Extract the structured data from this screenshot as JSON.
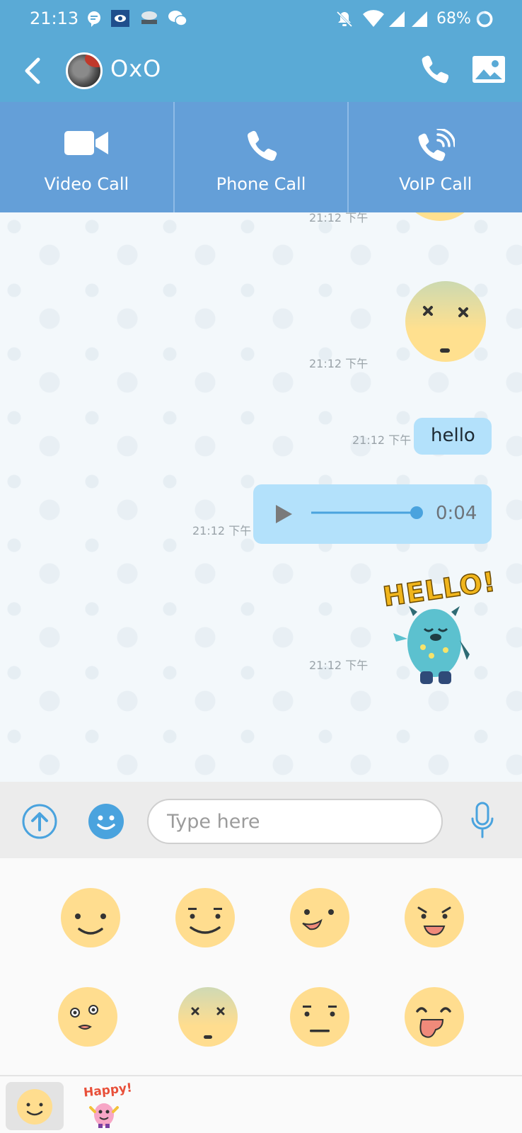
{
  "status_bar": {
    "time": "21:13",
    "battery": "68%",
    "notification_icons": [
      "message-bubble-icon",
      "news-app-icon",
      "weather-icon",
      "wechat-icon"
    ],
    "system_icons": [
      "mute-icon",
      "wifi-icon",
      "signal-icon",
      "signal-icon",
      "battery-ring-icon"
    ]
  },
  "header": {
    "contact_name": "OxO",
    "actions": [
      "phone-icon",
      "image-icon"
    ]
  },
  "call_options": [
    {
      "label": "Video Call",
      "icon": "video-camera-icon"
    },
    {
      "label": "Phone Call",
      "icon": "phone-icon"
    },
    {
      "label": "VoIP Call",
      "icon": "voip-phone-icon"
    }
  ],
  "messages": [
    {
      "type": "sticker",
      "sticker": "smiling-face",
      "time": "21:12 下午"
    },
    {
      "type": "sticker",
      "sticker": "dizzy-face",
      "time": "21:12 下午"
    },
    {
      "type": "text",
      "text": "hello",
      "time": "21:12 下午"
    },
    {
      "type": "voice",
      "duration": "0:04",
      "progress": 1.0,
      "time": "21:12 下午"
    },
    {
      "type": "sticker",
      "sticker": "hello-monster",
      "caption": "HELLO!",
      "time": "21:12 下午"
    }
  ],
  "input": {
    "placeholder": "Type here",
    "value": ""
  },
  "sticker_tray": [
    "smile-face",
    "smug-face",
    "grin-face",
    "mischief-face",
    "surprised-face",
    "dizzy-face",
    "neutral-face",
    "tongue-face"
  ],
  "tabs": [
    {
      "name": "emoji-faces",
      "active": true
    },
    {
      "name": "happy-monster",
      "label": "Happy!",
      "active": false
    }
  ],
  "colors": {
    "primary": "#5aaad6",
    "call_bar": "#649fd8",
    "bubble": "#b3e1fb",
    "face": "#ffdd8f",
    "accent": "#4aa3de"
  }
}
